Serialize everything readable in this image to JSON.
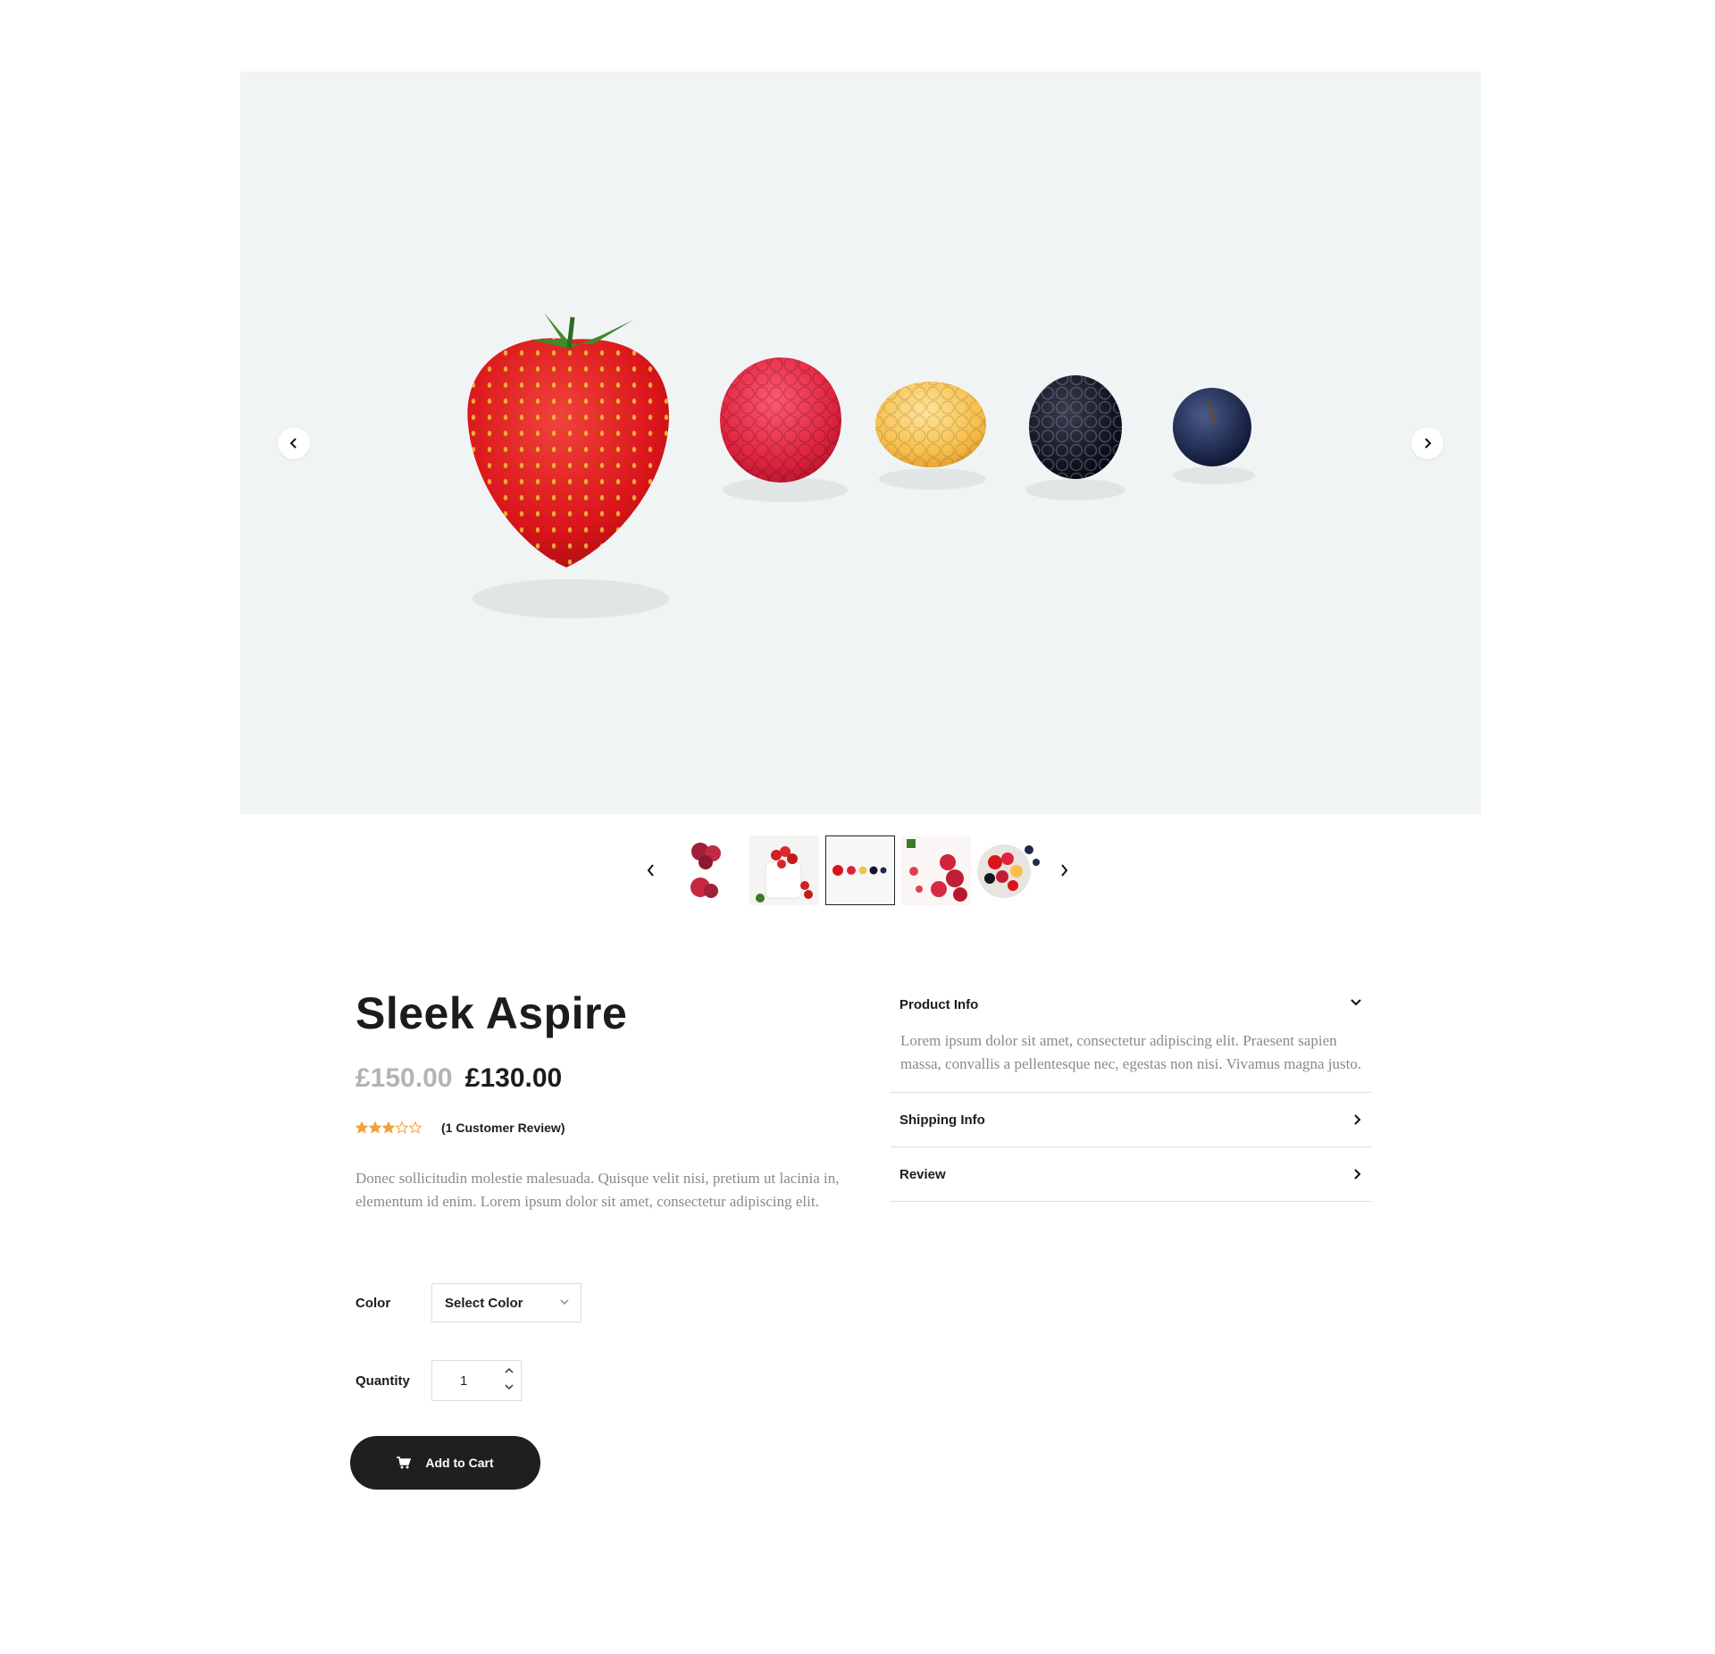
{
  "product": {
    "title": "Sleek Aspire",
    "price_old": "£150.00",
    "price_new": "£130.00",
    "rating": 3,
    "rating_max": 5,
    "review_count_label": "(1 Customer Review)",
    "description": "Donec sollicitudin molestie malesuada. Quisque velit nisi, pretium ut lacinia in, elementum id enim. Lorem ipsum dolor sit amet, consectetur adipiscing elit."
  },
  "options": {
    "color_label": "Color",
    "color_selected": "Select Color",
    "quantity_label": "Quantity",
    "quantity_value": "1"
  },
  "cart": {
    "label": "Add to Cart"
  },
  "gallery": {
    "active_index": 2,
    "thumb_count": 5
  },
  "accordion": {
    "product_info": {
      "title": "Product Info",
      "body": "Lorem ipsum dolor sit amet, consectetur adipiscing elit. Praesent sapien massa, convallis a pellentesque nec, egestas non nisi. Vivamus magna justo."
    },
    "shipping_info": {
      "title": "Shipping Info"
    },
    "review": {
      "title": "Review"
    }
  },
  "colors": {
    "hero_bg": "#f1f4f4",
    "star": "#f2a23a",
    "button": "#1f1f1f",
    "muted_text": "#8a8a8a",
    "old_price": "#b4b4b4"
  },
  "icons": {
    "hero_prev": "chevron-left-icon",
    "hero_next": "chevron-right-icon",
    "cart": "cart-icon",
    "select": "chevron-down-icon"
  }
}
